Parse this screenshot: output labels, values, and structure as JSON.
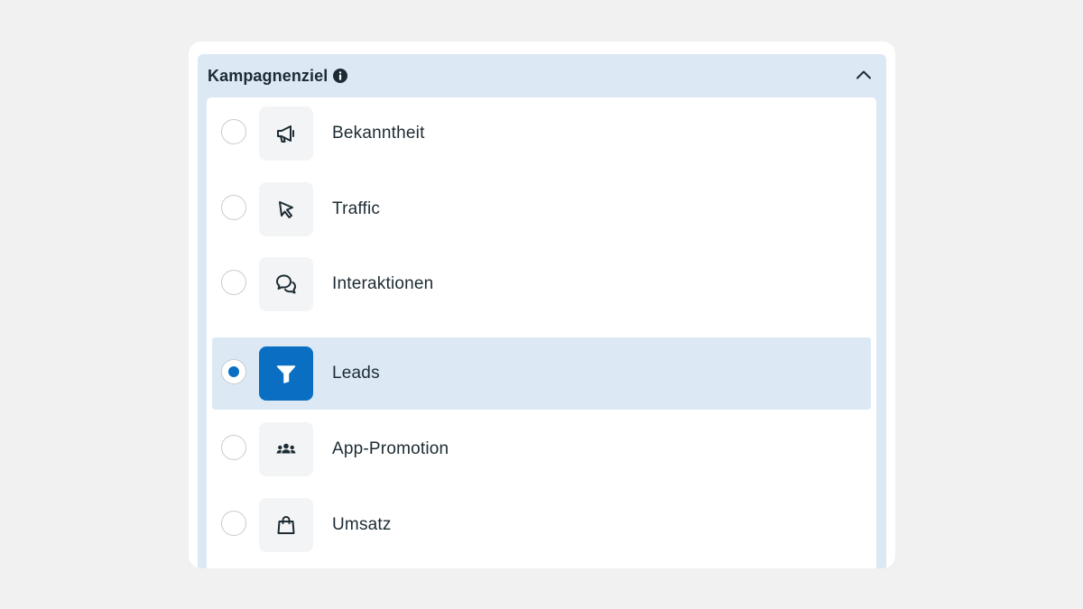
{
  "section": {
    "title": "Kampagnenziel",
    "info_icon": "info-icon",
    "toggle_icon": "chevron-up-icon"
  },
  "colors": {
    "page_background": "#f1f1f1",
    "section_background": "#dce9f5",
    "accent": "#0a6fc2",
    "text": "#1c2b33"
  },
  "options": [
    {
      "label": "Bekanntheit",
      "icon": "megaphone-icon",
      "selected": false
    },
    {
      "label": "Traffic",
      "icon": "cursor-icon",
      "selected": false
    },
    {
      "label": "Interaktionen",
      "icon": "chat-bubbles-icon",
      "selected": false
    },
    {
      "label": "Leads",
      "icon": "funnel-icon",
      "selected": true
    },
    {
      "label": "App-Promotion",
      "icon": "people-group-icon",
      "selected": false
    },
    {
      "label": "Umsatz",
      "icon": "shopping-bag-icon",
      "selected": false
    }
  ]
}
